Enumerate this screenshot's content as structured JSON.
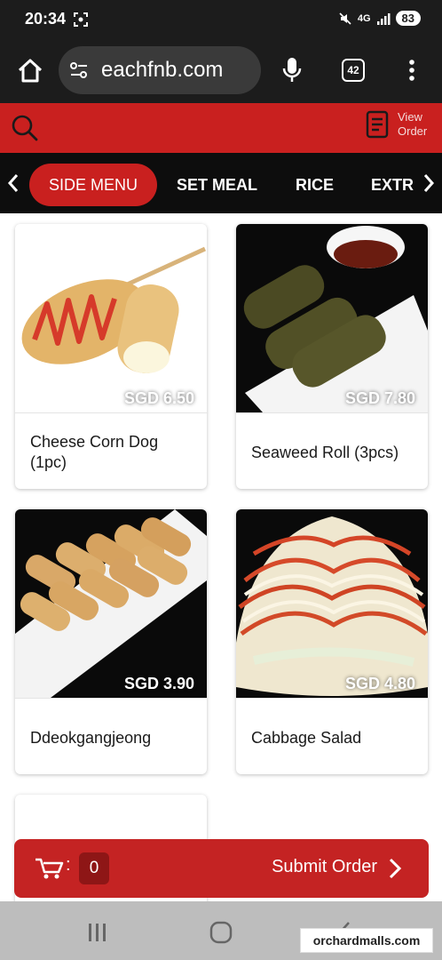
{
  "status": {
    "time": "20:34",
    "network": "4G",
    "battery": "83"
  },
  "browser": {
    "url": "eachfnb.com",
    "tab_count": "42"
  },
  "header": {
    "view_order_label_1": "View",
    "view_order_label_2": "Order"
  },
  "categories": [
    "SIDE MENU",
    "SET MEAL",
    "RICE",
    "EXTR"
  ],
  "products": [
    {
      "name": "Cheese Corn Dog (1pc)",
      "price": "SGD 6.50"
    },
    {
      "name": "Seaweed Roll (3pcs)",
      "price": "SGD 7.80"
    },
    {
      "name": "Ddeokgangjeong",
      "price": "SGD 3.90"
    },
    {
      "name": "Cabbage Salad",
      "price": "SGD 4.80"
    }
  ],
  "cart": {
    "separator": ":",
    "count": "0",
    "submit_label": "Submit Order"
  },
  "watermark": "orchardmalls.com"
}
